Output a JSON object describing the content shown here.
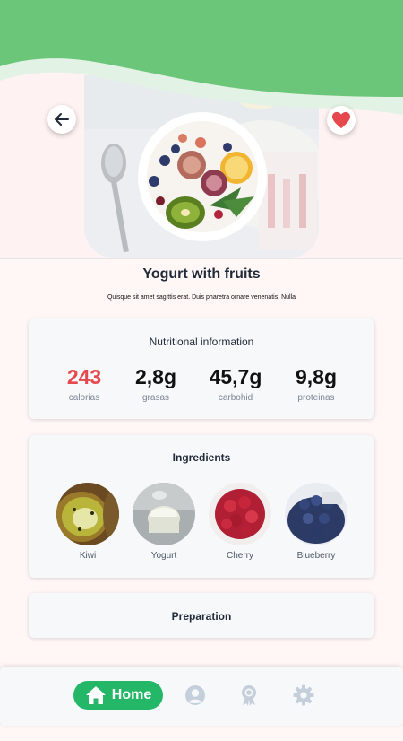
{
  "colors": {
    "accent": "#25b768",
    "header_green": "#6cc67a",
    "favorite": "#e5484d",
    "calories": "#e5484d"
  },
  "header": {
    "back_icon": "arrow-left-icon",
    "favorite_icon": "heart-icon"
  },
  "recipe": {
    "title": "Yogurt with fruits",
    "description": "Quisque sit amet sagittis erat. Duis pharetra ornare venenatis. Nulla"
  },
  "nutrition": {
    "title": "Nutritional information",
    "items": [
      {
        "value": "243",
        "label": "calorias"
      },
      {
        "value": "2,8g",
        "label": "grasas"
      },
      {
        "value": "45,7g",
        "label": "carbohid"
      },
      {
        "value": "9,8g",
        "label": "proteinas"
      }
    ]
  },
  "ingredients": {
    "title": "Ingredients",
    "items": [
      {
        "label": "Kiwi"
      },
      {
        "label": "Yogurt"
      },
      {
        "label": "Cherry"
      },
      {
        "label": "Blueberry"
      }
    ]
  },
  "preparation": {
    "title": "Preparation"
  },
  "navbar": {
    "home_label": "Home",
    "icons": [
      "home-icon",
      "user-icon",
      "award-icon",
      "settings-icon"
    ]
  }
}
